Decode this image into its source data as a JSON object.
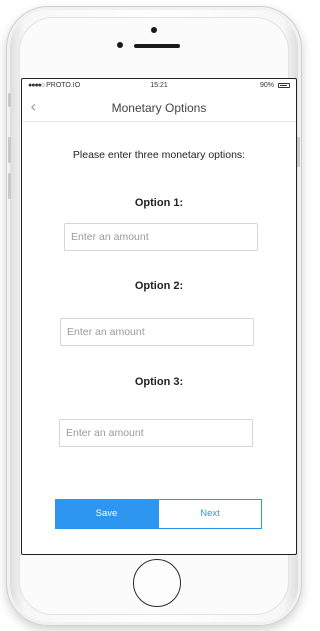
{
  "status_bar": {
    "carrier": "PROTO.IO",
    "signal": "●●●●○",
    "time": "15:21",
    "battery": "90%"
  },
  "nav": {
    "back_icon": "chevron-left-icon",
    "back_glyph": "‹",
    "title": "Monetary Options"
  },
  "form": {
    "prompt": "Please enter three monetary options:",
    "options": [
      {
        "label": "Option 1:",
        "placeholder": "Enter an amount",
        "value": ""
      },
      {
        "label": "Option 2:",
        "placeholder": "Enter an amount",
        "value": ""
      },
      {
        "label": "Option 3:",
        "placeholder": "Enter an amount",
        "value": ""
      }
    ]
  },
  "buttons": {
    "save": "Save",
    "next": "Next"
  },
  "colors": {
    "accent": "#2d96f0"
  }
}
